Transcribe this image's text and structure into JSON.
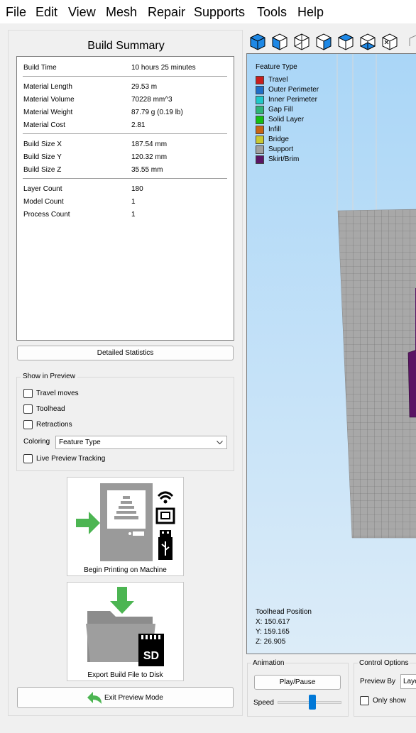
{
  "menu": [
    "File",
    "Edit",
    "View",
    "Mesh",
    "Repair",
    "Supports",
    "Tools",
    "Help"
  ],
  "summary": {
    "title": "Build Summary",
    "rows": [
      {
        "label": "Build Time",
        "value": "10 hours 25 minutes"
      },
      {
        "label": "Material Length",
        "value": "29.53 m"
      },
      {
        "label": "Material Volume",
        "value": "70228 mm^3"
      },
      {
        "label": "Material Weight",
        "value": "87.79 g (0.19 lb)"
      },
      {
        "label": "Material Cost",
        "value": "2.81"
      },
      {
        "label": "Build Size X",
        "value": "187.54 mm"
      },
      {
        "label": "Build Size Y",
        "value": "120.32 mm"
      },
      {
        "label": "Build Size Z",
        "value": "35.55 mm"
      },
      {
        "label": "Layer Count",
        "value": "180"
      },
      {
        "label": "Model Count",
        "value": "1"
      },
      {
        "label": "Process Count",
        "value": "1"
      }
    ],
    "detailed_button": "Detailed Statistics"
  },
  "preview": {
    "group_title": "Show in Preview",
    "travel_moves": "Travel moves",
    "toolhead": "Toolhead",
    "retractions": "Retractions",
    "coloring_label": "Coloring",
    "coloring_value": "Feature Type",
    "live_tracking": "Live Preview Tracking"
  },
  "actions": {
    "begin_printing": "Begin Printing on Machine",
    "export": "Export Build File to Disk",
    "sd_label": "SD",
    "exit_preview": "Exit Preview Mode"
  },
  "legend": {
    "title": "Feature Type",
    "items": [
      {
        "label": "Travel",
        "color": "#c81e1e"
      },
      {
        "label": "Outer Perimeter",
        "color": "#1e6ec8"
      },
      {
        "label": "Inner Perimeter",
        "color": "#1ec8c8"
      },
      {
        "label": "Gap Fill",
        "color": "#2db478"
      },
      {
        "label": "Solid Layer",
        "color": "#14be14"
      },
      {
        "label": "Infill",
        "color": "#c86414"
      },
      {
        "label": "Bridge",
        "color": "#c8c832"
      },
      {
        "label": "Support",
        "color": "#a0a0a0"
      },
      {
        "label": "Skirt/Brim",
        "color": "#5a1464"
      }
    ]
  },
  "toolhead_position": {
    "title": "Toolhead Position",
    "x": "X: 150.617",
    "y": "Y: 159.165",
    "z": "Z: 26.905"
  },
  "animation": {
    "title": "Animation",
    "play_pause": "Play/Pause",
    "speed_label": "Speed",
    "speed_level": 0.55
  },
  "control_options": {
    "title": "Control Options",
    "preview_by_label": "Preview By",
    "preview_by_value": "Laye",
    "only_show": "Only show"
  },
  "colors": {
    "accent": "#0078d7",
    "green_arrow": "#4cb552",
    "skirt": "#5a1464",
    "plate": "#a8a8a8"
  }
}
